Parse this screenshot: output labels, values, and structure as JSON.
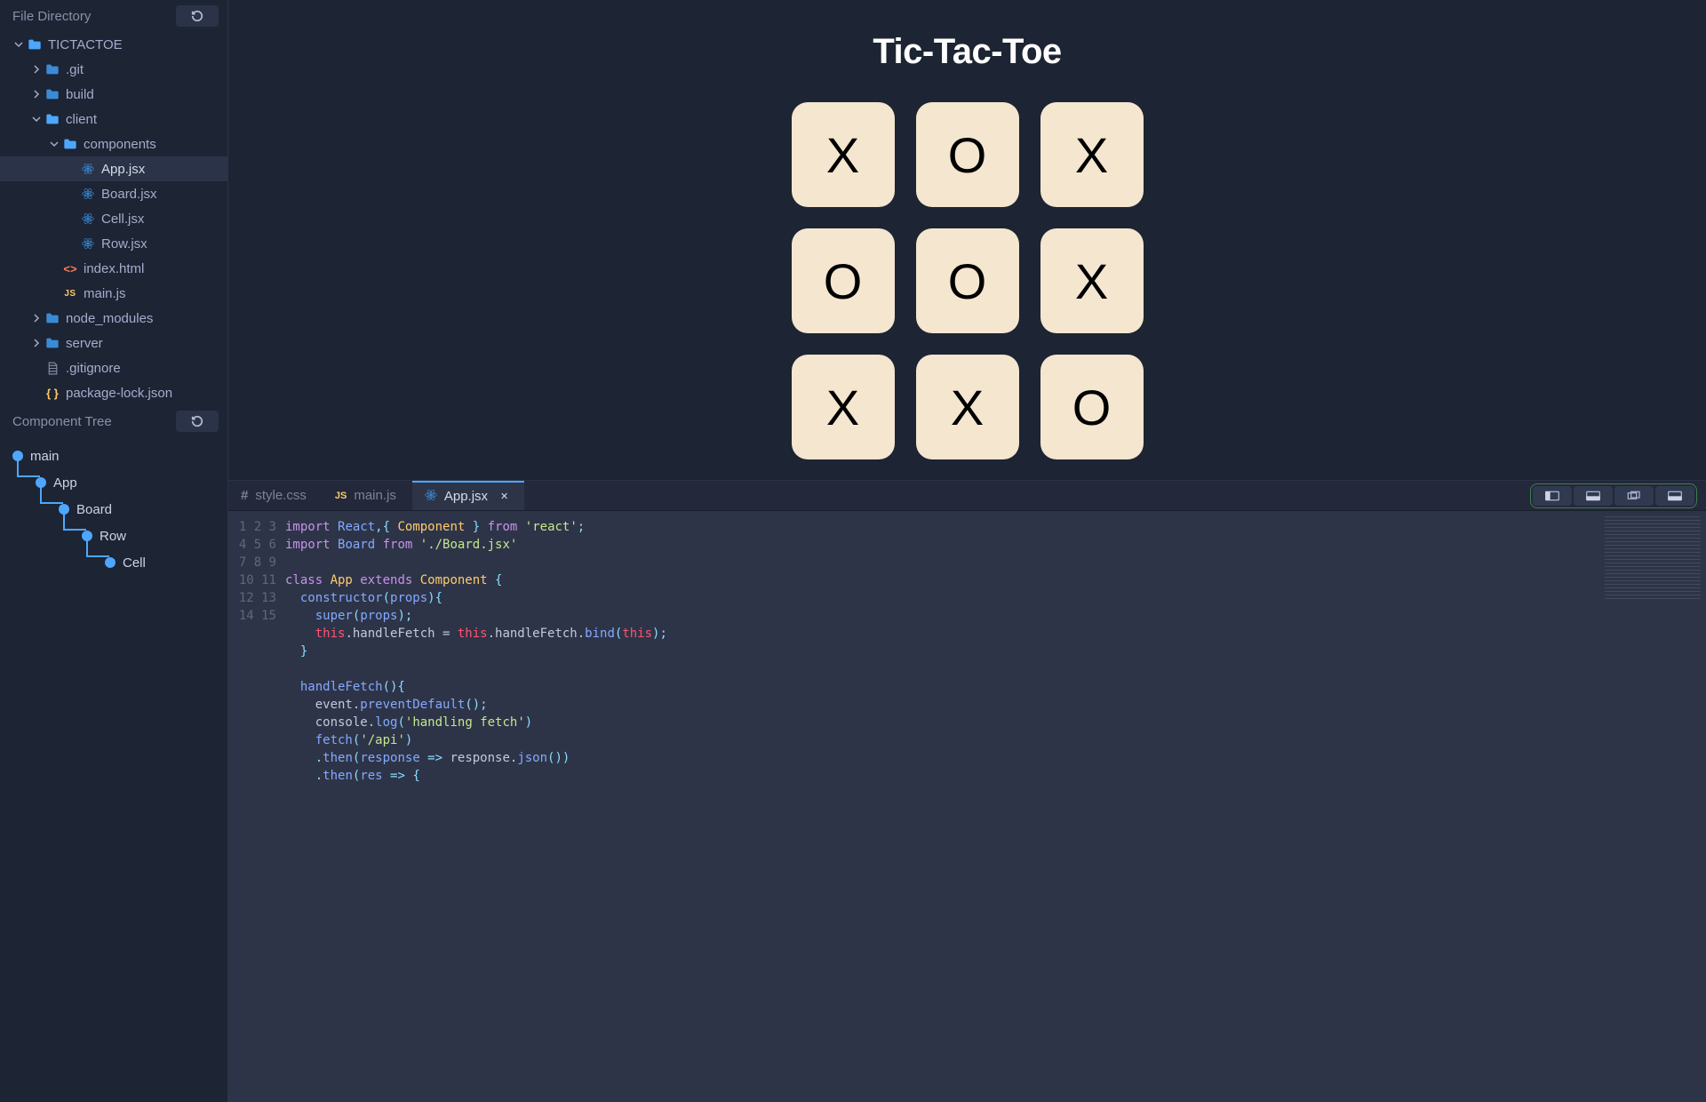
{
  "sidebar": {
    "file_directory_title": "File Directory",
    "component_tree_title": "Component Tree",
    "tree": [
      {
        "depth": 0,
        "kind": "folder-open",
        "label": "TICTACTOE",
        "expanded": true
      },
      {
        "depth": 1,
        "kind": "folder",
        "label": ".git",
        "expanded": false,
        "hasArrow": true
      },
      {
        "depth": 1,
        "kind": "folder",
        "label": "build",
        "expanded": false,
        "hasArrow": true
      },
      {
        "depth": 1,
        "kind": "folder-open",
        "label": "client",
        "expanded": true,
        "hasArrow": true
      },
      {
        "depth": 2,
        "kind": "folder-open",
        "label": "components",
        "expanded": true,
        "hasArrow": true
      },
      {
        "depth": 3,
        "kind": "react",
        "label": "App.jsx",
        "selected": true
      },
      {
        "depth": 3,
        "kind": "react",
        "label": "Board.jsx"
      },
      {
        "depth": 3,
        "kind": "react",
        "label": "Cell.jsx"
      },
      {
        "depth": 3,
        "kind": "react",
        "label": "Row.jsx"
      },
      {
        "depth": 2,
        "kind": "html",
        "label": "index.html"
      },
      {
        "depth": 2,
        "kind": "js",
        "label": "main.js"
      },
      {
        "depth": 1,
        "kind": "folder",
        "label": "node_modules",
        "expanded": false,
        "hasArrow": true
      },
      {
        "depth": 1,
        "kind": "folder",
        "label": "server",
        "expanded": false,
        "hasArrow": true
      },
      {
        "depth": 1,
        "kind": "file",
        "label": ".gitignore"
      },
      {
        "depth": 1,
        "kind": "brace",
        "label": "package-lock.json"
      }
    ],
    "component_nodes": [
      {
        "name": "main",
        "depth": 0
      },
      {
        "name": "App",
        "depth": 1
      },
      {
        "name": "Board",
        "depth": 2
      },
      {
        "name": "Row",
        "depth": 3
      },
      {
        "name": "Cell",
        "depth": 4
      }
    ]
  },
  "preview": {
    "title": "Tic-Tac-Toe",
    "board": [
      [
        "X",
        "O",
        "X"
      ],
      [
        "O",
        "O",
        "X"
      ],
      [
        "X",
        "X",
        "O"
      ]
    ]
  },
  "editor": {
    "tabs": [
      {
        "label": "style.css",
        "ext": "css"
      },
      {
        "label": "main.js",
        "ext": "js"
      },
      {
        "label": "App.jsx",
        "ext": "jsx",
        "active": true,
        "closable": true
      }
    ],
    "code_lines": [
      [
        {
          "t": "import ",
          "c": "kw"
        },
        {
          "t": "React",
          "c": "id"
        },
        {
          "t": ",{ ",
          "c": "pn"
        },
        {
          "t": "Component",
          "c": "cls"
        },
        {
          "t": " } ",
          "c": "pn"
        },
        {
          "t": "from ",
          "c": "kw"
        },
        {
          "t": "'react'",
          "c": "str"
        },
        {
          "t": ";",
          "c": "pn"
        }
      ],
      [
        {
          "t": "import ",
          "c": "kw"
        },
        {
          "t": "Board",
          "c": "id"
        },
        {
          "t": " ",
          "c": ""
        },
        {
          "t": "from ",
          "c": "kw"
        },
        {
          "t": "'./Board.jsx'",
          "c": "str"
        }
      ],
      [],
      [
        {
          "t": "class ",
          "c": "kw"
        },
        {
          "t": "App",
          "c": "cls"
        },
        {
          "t": " extends ",
          "c": "kw"
        },
        {
          "t": "Component",
          "c": "cls"
        },
        {
          "t": " {",
          "c": "pn"
        }
      ],
      [
        {
          "t": "  ",
          "c": ""
        },
        {
          "t": "constructor",
          "c": "fn"
        },
        {
          "t": "(",
          "c": "pn"
        },
        {
          "t": "props",
          "c": "id"
        },
        {
          "t": "){",
          "c": "pn"
        }
      ],
      [
        {
          "t": "    ",
          "c": ""
        },
        {
          "t": "super",
          "c": "fn"
        },
        {
          "t": "(",
          "c": "pn"
        },
        {
          "t": "props",
          "c": "id"
        },
        {
          "t": ");",
          "c": "pn"
        }
      ],
      [
        {
          "t": "    ",
          "c": ""
        },
        {
          "t": "this",
          "c": "th"
        },
        {
          "t": ".handleFetch = ",
          "c": ""
        },
        {
          "t": "this",
          "c": "th"
        },
        {
          "t": ".handleFetch.",
          "c": ""
        },
        {
          "t": "bind",
          "c": "fn"
        },
        {
          "t": "(",
          "c": "pn"
        },
        {
          "t": "this",
          "c": "th"
        },
        {
          "t": ");",
          "c": "pn"
        }
      ],
      [
        {
          "t": "  }",
          "c": "pn"
        }
      ],
      [],
      [
        {
          "t": "  ",
          "c": ""
        },
        {
          "t": "handleFetch",
          "c": "fn"
        },
        {
          "t": "(){",
          "c": "pn"
        }
      ],
      [
        {
          "t": "    event.",
          "c": ""
        },
        {
          "t": "preventDefault",
          "c": "fn"
        },
        {
          "t": "();",
          "c": "pn"
        }
      ],
      [
        {
          "t": "    console.",
          "c": ""
        },
        {
          "t": "log",
          "c": "fn"
        },
        {
          "t": "(",
          "c": "pn"
        },
        {
          "t": "'handling fetch'",
          "c": "str"
        },
        {
          "t": ")",
          "c": "pn"
        }
      ],
      [
        {
          "t": "    ",
          "c": ""
        },
        {
          "t": "fetch",
          "c": "fn"
        },
        {
          "t": "(",
          "c": "pn"
        },
        {
          "t": "'/api'",
          "c": "str"
        },
        {
          "t": ")",
          "c": "pn"
        }
      ],
      [
        {
          "t": "    .",
          "c": "pn"
        },
        {
          "t": "then",
          "c": "fn"
        },
        {
          "t": "(",
          "c": "pn"
        },
        {
          "t": "response",
          "c": "id"
        },
        {
          "t": " => ",
          "c": "op"
        },
        {
          "t": "response.",
          "c": ""
        },
        {
          "t": "json",
          "c": "fn"
        },
        {
          "t": "())",
          "c": "pn"
        }
      ],
      [
        {
          "t": "    .",
          "c": "pn"
        },
        {
          "t": "then",
          "c": "fn"
        },
        {
          "t": "(",
          "c": "pn"
        },
        {
          "t": "res",
          "c": "id"
        },
        {
          "t": " => {",
          "c": "pn"
        }
      ]
    ]
  }
}
